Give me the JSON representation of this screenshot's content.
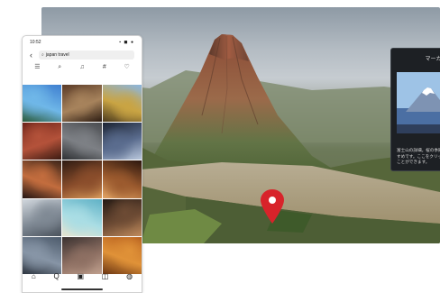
{
  "phone": {
    "status_time": "10:52",
    "status_icons": "▪ ◼ ●",
    "search_query": "japan travel",
    "back_glyph": "‹",
    "search_glyph": "⌕",
    "filter_icons": [
      "☰",
      "⌕",
      "♫",
      "#",
      "♡"
    ],
    "photos": [
      {
        "name": "beach-bay",
        "colors": [
          "#3f7fd0",
          "#6fb7e8",
          "#2a5a3a"
        ]
      },
      {
        "name": "wooden-inn",
        "colors": [
          "#5a3a26",
          "#a7835c",
          "#2c1c12"
        ]
      },
      {
        "name": "golden-temple",
        "colors": [
          "#8bb6e0",
          "#c9a443",
          "#4b3a1e"
        ]
      },
      {
        "name": "red-maple-shrine",
        "colors": [
          "#6d2318",
          "#b4523a",
          "#3b1b12"
        ]
      },
      {
        "name": "stone-garden",
        "colors": [
          "#4a4c50",
          "#7d8085",
          "#2e3033"
        ]
      },
      {
        "name": "city-night",
        "colors": [
          "#1c2433",
          "#5a6c8e",
          "#b9c7dc"
        ]
      },
      {
        "name": "pagoda-sunset",
        "colors": [
          "#3c2418",
          "#c36d3e",
          "#221412"
        ]
      },
      {
        "name": "lantern-street",
        "colors": [
          "#2e1b12",
          "#8a4d2b",
          "#d89a5a"
        ]
      },
      {
        "name": "lantern-shop",
        "colors": [
          "#2c170e",
          "#9b5a2e",
          "#e2a464"
        ]
      },
      {
        "name": "winter-temple",
        "colors": [
          "#d2d8de",
          "#7f8994",
          "#4a525c"
        ]
      },
      {
        "name": "tropical-beach",
        "colors": [
          "#5fb1c6",
          "#a9dde4",
          "#e6e3cf"
        ]
      },
      {
        "name": "cave-lights",
        "colors": [
          "#251a14",
          "#6d4b34",
          "#c08b5c"
        ]
      },
      {
        "name": "canal-town",
        "colors": [
          "#4c5a6b",
          "#8795a6",
          "#2d3540"
        ]
      },
      {
        "name": "old-street",
        "colors": [
          "#3a3130",
          "#8d6f62",
          "#bf9f8d"
        ]
      },
      {
        "name": "autumn-path",
        "colors": [
          "#b25a1c",
          "#e09238",
          "#6b3512"
        ]
      }
    ],
    "tab_icons": [
      "⌂",
      "Q",
      "▣",
      "◫",
      "◍"
    ]
  },
  "map": {
    "sky_colors": [
      "#8e9aa5",
      "#c6ccd1"
    ],
    "mountain_colors": [
      "#7a3f2e",
      "#a4583e",
      "#546a3c"
    ],
    "pin_color": "#d8232a"
  },
  "info_panel": {
    "title": "マーカー",
    "description": "富士山の詳細。桜の季節に訪れるのがおすすめです。ここをクリックして詳細を見ることができます。"
  }
}
